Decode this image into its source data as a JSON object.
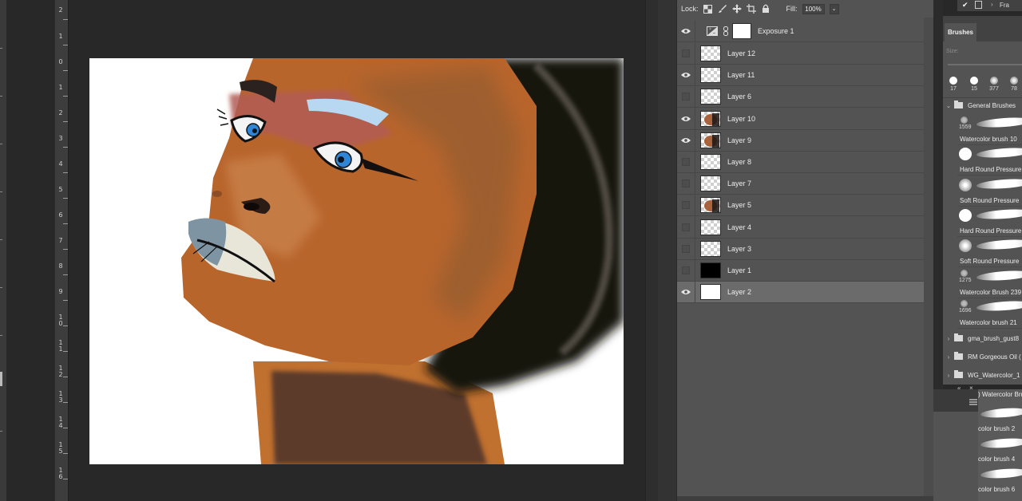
{
  "ruler": {
    "labels": [
      "2",
      "1",
      "0",
      "1",
      "2",
      "3",
      "4",
      "5",
      "6",
      "7",
      "8",
      "9",
      "10",
      "11",
      "12",
      "13",
      "14",
      "15",
      "16"
    ]
  },
  "layers_panel": {
    "lock_label": "Lock:",
    "fill_label": "Fill:",
    "fill_value": "100%",
    "adjustment_layer": {
      "name": "Exposure 1",
      "visible": true,
      "icon": "exposure-adjustment-icon"
    },
    "layers": [
      {
        "name": "Layer 12",
        "visible": false,
        "thumb": "transparent"
      },
      {
        "name": "Layer 11",
        "visible": true,
        "thumb": "transparent"
      },
      {
        "name": "Layer 6",
        "visible": false,
        "thumb": "transparent"
      },
      {
        "name": "Layer 10",
        "visible": true,
        "thumb": "painted"
      },
      {
        "name": "Layer 9",
        "visible": true,
        "thumb": "painted"
      },
      {
        "name": "Layer 8",
        "visible": false,
        "thumb": "transparent"
      },
      {
        "name": "Layer 7",
        "visible": false,
        "thumb": "transparent"
      },
      {
        "name": "Layer 5",
        "visible": false,
        "thumb": "painted"
      },
      {
        "name": "Layer 4",
        "visible": false,
        "thumb": "transparent"
      },
      {
        "name": "Layer 3",
        "visible": false,
        "thumb": "transparent"
      },
      {
        "name": "Layer 1",
        "visible": false,
        "thumb": "black"
      },
      {
        "name": "Layer 2",
        "visible": true,
        "thumb": "white",
        "selected": true
      }
    ]
  },
  "frame_strip": {
    "label": "Fra"
  },
  "brushes_panel": {
    "tab_label": "Brushes",
    "size_label": "Size:",
    "presets": [
      {
        "size": "17",
        "kind": "hard"
      },
      {
        "size": "15",
        "kind": "hard"
      },
      {
        "size": "377",
        "kind": "textured"
      },
      {
        "size": "78",
        "kind": "textured"
      }
    ],
    "open_folder": "General Brushes",
    "brushes": [
      {
        "name": "Watercolor brush 10",
        "count": "1559",
        "kind": "textured"
      },
      {
        "name": "Hard Round Pressure",
        "count": "",
        "kind": "hard"
      },
      {
        "name": "Soft Round Pressure",
        "count": "",
        "kind": "soft"
      },
      {
        "name": "Hard Round Pressure",
        "count": "",
        "kind": "hard"
      },
      {
        "name": "Soft Round Pressure",
        "count": "",
        "kind": "soft"
      },
      {
        "name": "Watercolor Brush 239",
        "count": "1275",
        "kind": "textured"
      },
      {
        "name": "Watercolor brush 21",
        "count": "1696",
        "kind": "textured"
      }
    ],
    "folders": [
      "gma_brush_gust8",
      "RM Gorgeous Oil (",
      "WG_Watercolor_1"
    ]
  },
  "lower_panel": {
    "tab_label": ") Watercolor Bru",
    "brushes": [
      "color brush 2",
      "color brush 4",
      "color brush 6"
    ]
  },
  "colors": {
    "workspace_bg": "#282828",
    "panel_bg": "#535353",
    "selected_row": "#6b6b6b",
    "skin": "#b8652c",
    "iris_blue": "#2f86d6"
  }
}
